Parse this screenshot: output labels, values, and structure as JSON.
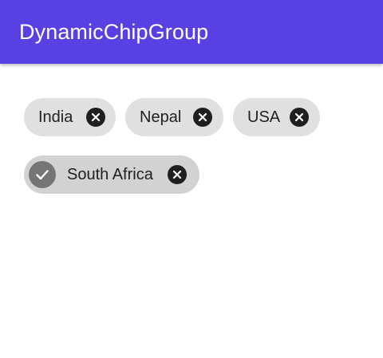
{
  "appbar": {
    "title": "DynamicChipGroup",
    "color": "#5840e3"
  },
  "chips": [
    {
      "label": "India",
      "checked": false,
      "icon": "close-icon"
    },
    {
      "label": "Nepal",
      "checked": false,
      "icon": "close-icon"
    },
    {
      "label": "USA",
      "checked": false,
      "icon": "close-icon"
    },
    {
      "label": "South Africa",
      "checked": true,
      "icon": "close-icon",
      "check_icon": "check-icon"
    }
  ]
}
